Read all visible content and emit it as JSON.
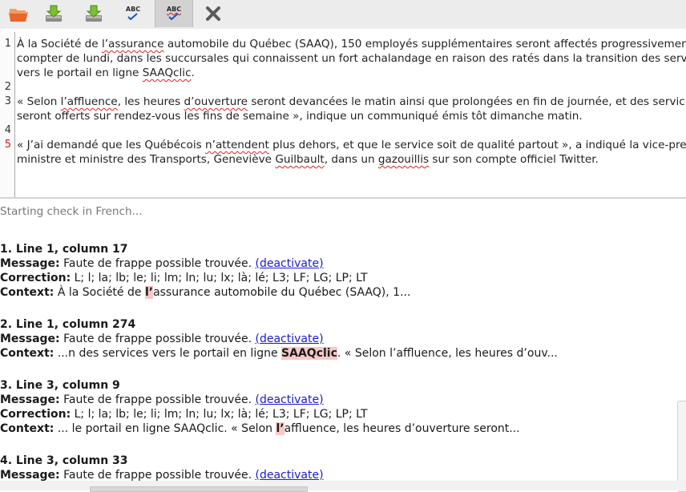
{
  "toolbar": {
    "buttons": [
      {
        "name": "open-folder",
        "tooltip": ""
      },
      {
        "name": "download-down",
        "tooltip": ""
      },
      {
        "name": "download-save",
        "tooltip": ""
      },
      {
        "name": "spellcheck",
        "label": "ABC"
      },
      {
        "name": "spellcheck-active",
        "label": "ABC"
      },
      {
        "name": "close",
        "label": ""
      }
    ]
  },
  "editor": {
    "line_numbers": [
      "1",
      "2",
      "3",
      "4",
      "5"
    ],
    "lines": [
      [
        "À la Société de ",
        "l’assurance",
        " automobile du Québec (SAAQ), 150 employés supplémentaires seront affectés progressivement"
      ],
      [
        "compter de lundi, dans les succursales qui connaissent un fort achalandage en raison des ratés dans la transition des servi"
      ],
      [
        "vers le portail en ligne ",
        "SAAQclic",
        "."
      ],
      [
        ""
      ],
      [
        "« Selon ",
        "l’affluence",
        ", les heures ",
        "d’ouverture",
        " seront devancées le matin ainsi que prolongées en fin de journée, et des servic"
      ],
      [
        "seront offerts sur rendez-vous les fins de semaine », indique un communiqué émis tôt dimanche matin."
      ],
      [
        ""
      ],
      [
        "« J’ai demandé que les Québécois ",
        "n’attendent",
        " plus dehors, et que le service soit de qualité partout », a indiqué la vice-pre"
      ],
      [
        "ministre et ministre des Transports, Geneviève ",
        "Guilbault",
        ", dans un ",
        "gazouillis",
        " sur son compte officiel Twitter."
      ]
    ]
  },
  "results": {
    "starting": "Starting check in French...",
    "labels": {
      "message": "Message:",
      "correction": "Correction:",
      "context": "Context:",
      "deactivate": "(deactivate)"
    },
    "entries": [
      {
        "header": "1. Line 1, column 17",
        "message": "Faute de frappe possible trouvée.",
        "correction": "L; l; la; lb; le; li; lm; ln; lu; lx; là; lé; L3; LF; LG; LP; LT",
        "context_before": "À la Société de ",
        "context_hl": "l’",
        "context_after": "assurance automobile du Québec (SAAQ), 1..."
      },
      {
        "header": "2. Line 1, column 274",
        "message": "Faute de frappe possible trouvée.",
        "context_before": "...n des services vers le portail en ligne ",
        "context_hl": "SAAQclic",
        "context_after": ". « Selon l’affluence, les heures d’ouv..."
      },
      {
        "header": "3. Line 3, column 9",
        "message": "Faute de frappe possible trouvée.",
        "correction": "L; l; la; lb; le; li; lm; ln; lu; lx; là; lé; L3; LF; LG; LP; LT",
        "context_before": "... le portail en ligne SAAQclic. « Selon ",
        "context_hl": "l’",
        "context_after": "affluence, les heures d’ouverture seront..."
      },
      {
        "header": "4. Line 3, column 33",
        "message": "Faute de frappe possible trouvée."
      }
    ]
  },
  "colors": {
    "error_line_number": "#d01818",
    "highlight": "#f7c8c8",
    "link": "#1a1ad0"
  }
}
